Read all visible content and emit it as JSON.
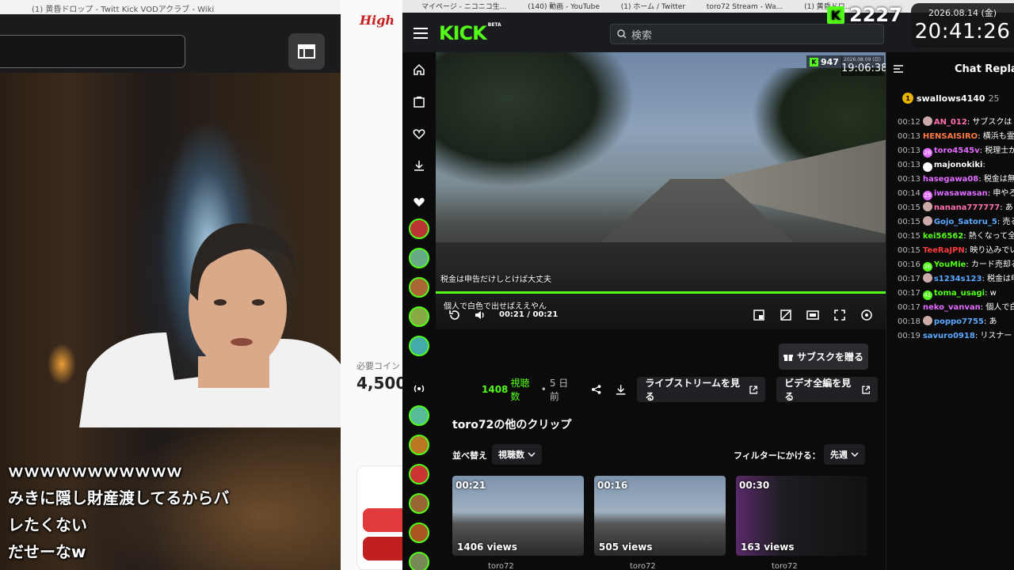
{
  "left_browser": {
    "tab_text": "(1) 黄昏ドロップ - Twitt    Kick VODアクラブ - Wiki"
  },
  "subtitles": [
    "ｗｗｗｗｗｗｗｗｗｗｗ",
    "みきに隠し財産渡してるからバ",
    "レたくない",
    "だせーなw"
  ],
  "middle_panel": {
    "logo": "High",
    "coin_label": "必要コイン",
    "coin_value": "4,500"
  },
  "browser_tabs": [
    "マイページ - ニコニコ生...",
    "(140) 動画 - YouTube",
    "(1) ホーム / Twitter",
    "toro72 Stream - Wa...",
    "(1) 黄昏ドロ..."
  ],
  "overlay": {
    "viewer_count": "2227",
    "date": "2026.08.14 (金)",
    "time": "20:41:26"
  },
  "kick": {
    "logo": "KICK",
    "logo_badge": "BETA",
    "search_placeholder": "検索",
    "video": {
      "viewer_count": "947",
      "stream_date": "2026.08.09 (日)",
      "stream_time": "19:06:38",
      "caption_1": "税金は申告だけしとけば大丈夫",
      "caption_2": "個人で白色で出せばええやん",
      "timecode": "00:21 / 00:21"
    },
    "gift_button": "サブスクを贈る",
    "meta": {
      "views": "1408",
      "views_unit": "視聴数",
      "posted": "5 日前",
      "live_button": "ライブストリームを見る",
      "vod_button": "ビデオ全編を見る"
    },
    "clips_title": "toro72の他のクリップ",
    "sort_label": "並べ替え",
    "sort_value": "視聴数",
    "filter_label": "フィルターにかける：",
    "filter_value": "先週",
    "clips": [
      {
        "duration": "00:21",
        "views": "1406 views",
        "user": "toro72"
      },
      {
        "duration": "00:16",
        "views": "505 views",
        "user": "toro72"
      },
      {
        "duration": "00:30",
        "views": "163 views",
        "user": "toro72"
      }
    ]
  },
  "chat": {
    "title": "Chat Replay",
    "pinned_user": "swallows4140",
    "pinned_count": "25",
    "messages": [
      {
        "time": "00:12",
        "user": "AN_012",
        "text": "サブスクは",
        "color": "#ff6fb0",
        "badge": "avatar"
      },
      {
        "time": "00:13",
        "user": "HENSAISIRO",
        "text": "横浜も霊",
        "color": "#ff7a45",
        "badge": ""
      },
      {
        "time": "00:13",
        "user": "toro4545v",
        "text": "税理士がやろ",
        "color": "#e26bff",
        "badge": "26"
      },
      {
        "time": "00:13",
        "user": "majonokiki",
        "text": "",
        "color": "#ffffff",
        "badge": "40"
      },
      {
        "time": "00:13",
        "user": "hasegawa08",
        "text": "税金は無",
        "color": "#e26bff",
        "badge": ""
      },
      {
        "time": "00:14",
        "user": "iwasawasan",
        "text": "申やろ",
        "color": "#e26bff",
        "badge": "25"
      },
      {
        "time": "00:15",
        "user": "nanana777777",
        "text": "あ",
        "color": "#ff6fb0",
        "badge": "avatar"
      },
      {
        "time": "00:15",
        "user": "Gojo_Satoru_5",
        "text": "売るえて詰むんだけど大丈夫？",
        "color": "#5aa9ff",
        "badge": "avatar"
      },
      {
        "time": "00:15",
        "user": "kei56562",
        "text": "熱くなって全に！いつもお金持ったら全部使",
        "color": "#53fc18",
        "badge": ""
      },
      {
        "time": "00:15",
        "user": "TeeRaJPN",
        "text": "映り込みでいんか？",
        "color": "#ff3b3b",
        "badge": ""
      },
      {
        "time": "00:16",
        "user": "YouMie",
        "text": "カード売却るやろ",
        "color": "#53fc18",
        "badge": "26"
      },
      {
        "time": "00:17",
        "user": "s1234s123",
        "text": "税金は申大丈夫",
        "color": "#5aa9ff",
        "badge": "avatar"
      },
      {
        "time": "00:17",
        "user": "toma_usagi",
        "text": "w",
        "color": "#53fc18",
        "badge": "41"
      },
      {
        "time": "00:17",
        "user": "neko_vanvan",
        "text": "個人で白やん",
        "color": "#e26bff",
        "badge": ""
      },
      {
        "time": "00:18",
        "user": "poppo7755",
        "text": "あ",
        "color": "#5aa9ff",
        "badge": "avatar"
      },
      {
        "time": "00:19",
        "user": "savuro0918",
        "text": "リスナー",
        "color": "#5aa9ff",
        "badge": ""
      }
    ]
  },
  "colors": {
    "kick_green": "#53fc18",
    "bg": "#0b0b0c"
  }
}
